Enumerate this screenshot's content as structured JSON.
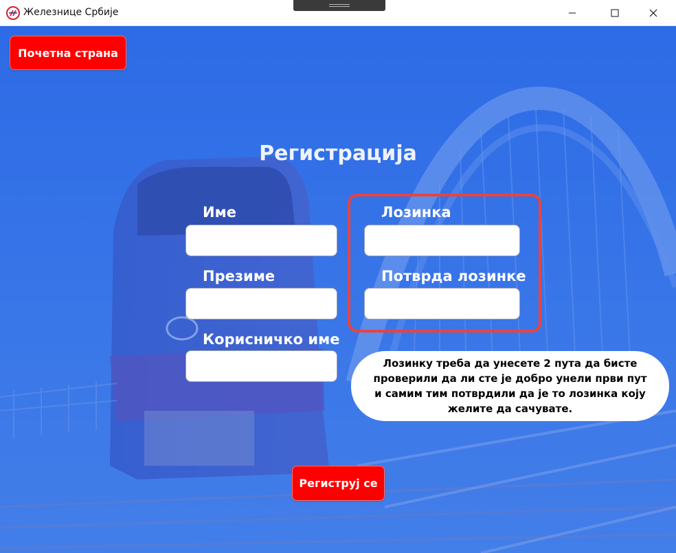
{
  "window": {
    "title": "Железнице Србије",
    "app_icon": "zs-logo-icon",
    "controls": [
      "minimize-icon",
      "maximize-icon",
      "close-icon"
    ]
  },
  "nav": {
    "home_label": "Почетна страна"
  },
  "form": {
    "title": "Регистрација",
    "fields": {
      "first_name": {
        "label": "Име",
        "value": ""
      },
      "last_name": {
        "label": "Презиме",
        "value": ""
      },
      "username": {
        "label": "Корисничко име",
        "value": ""
      },
      "password": {
        "label": "Лозинка",
        "value": ""
      },
      "confirm_password": {
        "label": "Потврда лозинке",
        "value": ""
      }
    },
    "submit_label": "Региструј се"
  },
  "hint": {
    "text": "Лозинку треба да унесете 2 пута да бисте проверили да ли сте је добро унели први пут и самим тим потврдили да је то лозинка коју желите да сачувате."
  },
  "colors": {
    "accent_red": "#ff0000",
    "highlight": "#e9433f",
    "background_blue": "#3a78ea"
  }
}
